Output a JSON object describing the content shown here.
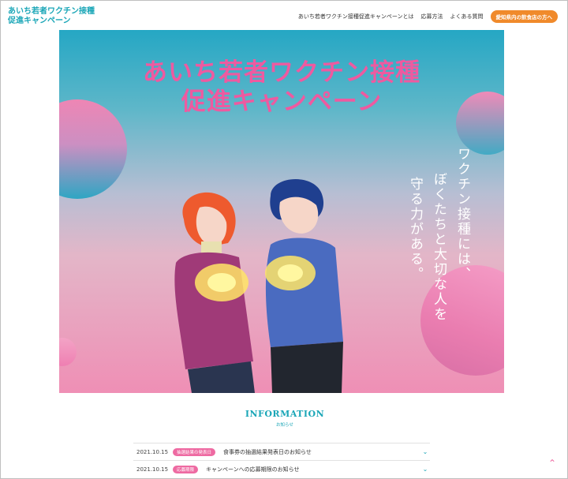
{
  "header": {
    "logo_line1": "あいち若者ワクチン接種",
    "logo_line2": "促進キャンペーン",
    "nav": {
      "about": "あいち若者ワクチン接種促進キャンペーンとは",
      "apply": "応募方法",
      "faq": "よくある質問",
      "cta": "愛知県内の飲食店の方へ"
    }
  },
  "hero": {
    "title_line1": "あいち若者ワクチン接種",
    "title_line2": "促進キャンペーン",
    "tagline_col1": "ワクチン接種には、",
    "tagline_col2": "ぼくたちと大切な人を",
    "tagline_col3": "守る力がある。"
  },
  "information": {
    "title": "INFORMATION",
    "subtitle": "お知らせ",
    "items": [
      {
        "date": "2021.10.15",
        "badge": "抽選結果の発表日",
        "text": "食事券の抽選結果発表日のお知らせ"
      },
      {
        "date": "2021.10.15",
        "badge": "応募期限",
        "text": "キャンペーンへの応募期限のお知らせ"
      }
    ]
  },
  "colors": {
    "brand": "#1aa6b7",
    "accent_pink": "#ee5aa0",
    "cta_orange": "#f08a2b"
  },
  "icons": {
    "news_expand": "chevron-down-icon",
    "scroll_top": "chevron-up-icon"
  }
}
